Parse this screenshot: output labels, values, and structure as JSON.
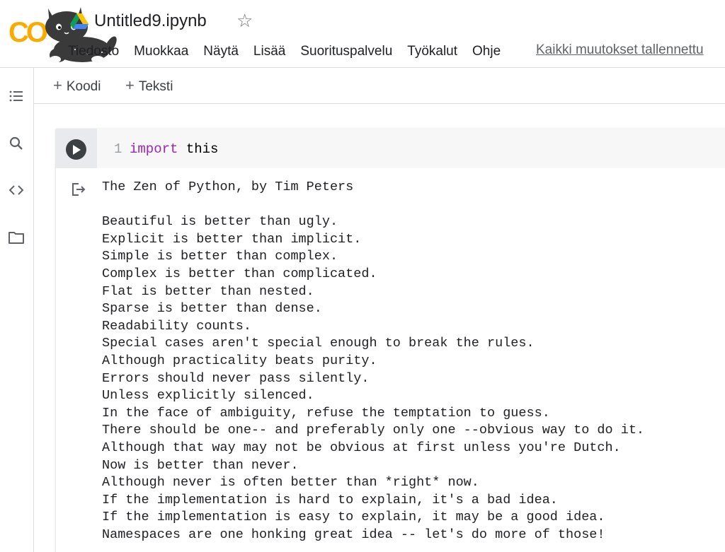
{
  "header": {
    "logo_text": "CO",
    "title": "Untitled9.ipynb",
    "star_icon": "star-outline-icon",
    "save_status": "Kaikki muutokset tallennettu"
  },
  "menu": {
    "items": [
      {
        "label": "Tiedosto"
      },
      {
        "label": "Muokkaa"
      },
      {
        "label": "Näytä"
      },
      {
        "label": "Lisää"
      },
      {
        "label": "Suorituspalvelu"
      },
      {
        "label": "Työkalut"
      },
      {
        "label": "Ohje"
      }
    ]
  },
  "left_rail": {
    "icons": [
      "toc-icon",
      "search-icon",
      "code-snippets-icon",
      "folder-icon"
    ]
  },
  "toolbar": {
    "plus": "+",
    "add_code_label": "Koodi",
    "add_text_label": "Teksti"
  },
  "cell": {
    "line_number": "1",
    "code_keyword": "import",
    "code_rest": " this",
    "output": "The Zen of Python, by Tim Peters\n\nBeautiful is better than ugly.\nExplicit is better than implicit.\nSimple is better than complex.\nComplex is better than complicated.\nFlat is better than nested.\nSparse is better than dense.\nReadability counts.\nSpecial cases aren't special enough to break the rules.\nAlthough practicality beats purity.\nErrors should never pass silently.\nUnless explicitly silenced.\nIn the face of ambiguity, refuse the temptation to guess.\nThere should be one-- and preferably only one --obvious way to do it.\nAlthough that way may not be obvious at first unless you're Dutch.\nNow is better than never.\nAlthough never is often better than *right* now.\nIf the implementation is hard to explain, it's a bad idea.\nIf the implementation is easy to explain, it may be a good idea.\nNamespaces are one honking great idea -- let's do more of those!"
  },
  "colors": {
    "logo_orange": "#F9AB00",
    "logo_dark_orange": "#E8710A",
    "keyword": "#9c27b0",
    "run_button": "#3c4043"
  }
}
